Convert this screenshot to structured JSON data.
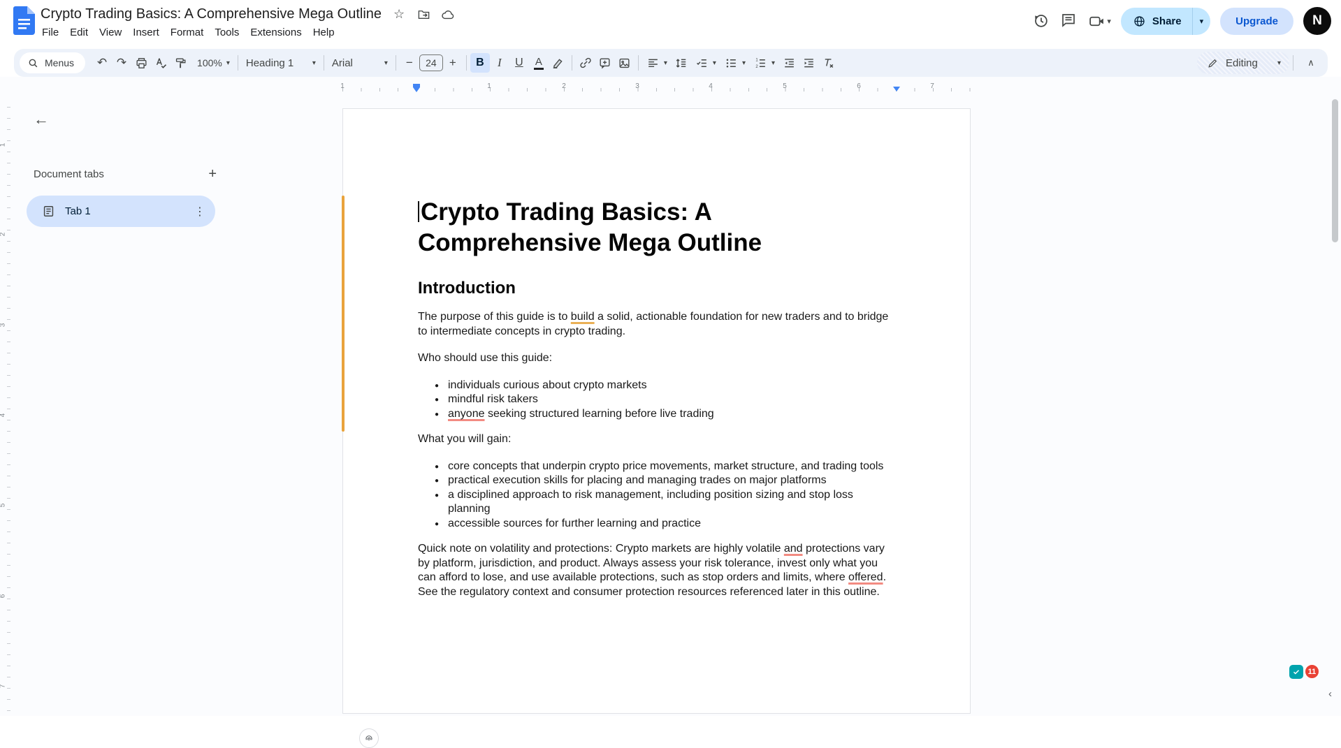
{
  "icons": {
    "star": "☆",
    "back_arrow": "←",
    "plus": "+",
    "overflow_menu": "⋮",
    "caret_down": "▾",
    "chevron_up": "∧",
    "minus": "−",
    "undo": "↶",
    "redo": "↷",
    "panel_collapse": "‹"
  },
  "titlebar": {
    "doc_title": "Crypto Trading Basics: A Comprehensive Mega Outline",
    "menus": [
      "File",
      "Edit",
      "View",
      "Insert",
      "Format",
      "Tools",
      "Extensions",
      "Help"
    ],
    "share_label": "Share",
    "upgrade_label": "Upgrade",
    "avatar_letter": "N"
  },
  "toolbar": {
    "menus_label": "Menus",
    "zoom_value": "100%",
    "style_value": "Heading 1",
    "font_value": "Arial",
    "font_size_value": "24",
    "bold_label": "B",
    "italic_label": "I",
    "underline_label": "U",
    "text_color_label": "A",
    "mode_label": "Editing"
  },
  "tabs_panel": {
    "header": "Document tabs",
    "tabs": [
      {
        "label": "Tab 1"
      }
    ]
  },
  "ruler": {
    "h_numbers": [
      "1",
      "1",
      "2",
      "3",
      "4",
      "5",
      "6",
      "7"
    ],
    "v_numbers": [
      "1",
      "2",
      "3",
      "4",
      "5",
      "6",
      "7"
    ]
  },
  "document": {
    "blocks": [
      {
        "type": "h1",
        "runs": [
          {
            "t": "Crypto Trading Basics: A Comprehensive Mega Outline"
          }
        ]
      },
      {
        "type": "h2",
        "runs": [
          {
            "t": "Introduction"
          }
        ]
      },
      {
        "type": "p",
        "runs": [
          {
            "t": "The purpose of this guide is to "
          },
          {
            "t": "build",
            "mark": "orange"
          },
          {
            "t": " a solid, actionable foundation for new traders and to bridge to intermediate concepts in crypto trading."
          }
        ]
      },
      {
        "type": "p",
        "runs": [
          {
            "t": "Who should use this guide:"
          }
        ]
      },
      {
        "type": "ul",
        "items": [
          [
            {
              "t": "individuals curious about crypto markets"
            }
          ],
          [
            {
              "t": "mindful risk takers"
            }
          ],
          [
            {
              "t": "anyone",
              "mark": "pink"
            },
            {
              "t": " seeking structured learning before live trading"
            }
          ]
        ]
      },
      {
        "type": "p",
        "runs": [
          {
            "t": "What you will gain:"
          }
        ]
      },
      {
        "type": "ul",
        "items": [
          [
            {
              "t": "core concepts that underpin crypto price movements, market structure, and trading tools"
            }
          ],
          [
            {
              "t": "practical execution skills for placing and managing trades on major platforms"
            }
          ],
          [
            {
              "t": "a disciplined approach to risk management, including position sizing and stop loss planning"
            }
          ],
          [
            {
              "t": "accessible sources for further learning and practice"
            }
          ]
        ]
      },
      {
        "type": "p",
        "runs": [
          {
            "t": "Quick note on volatility and protections: Crypto markets are highly volatile "
          },
          {
            "t": "and",
            "mark": "pink"
          },
          {
            "t": " protections vary by platform, jurisdiction, and product. Always assess your risk tolerance, invest only what you can afford to lose, and use available protections, such as stop orders and limits, where "
          },
          {
            "t": "offered",
            "mark": "pink"
          },
          {
            "t": ". See the regulatory context and consumer protection resources referenced later in this outline."
          }
        ]
      }
    ]
  },
  "page_badges": {
    "notification_count": "11"
  },
  "colors": {
    "accent_blue": "#0b57d0",
    "share_pill_blue": "#c2e7ff",
    "selection_blue": "#d3e3fd",
    "toolbar_bg": "#edf2fa",
    "underline_orange": "#eab055",
    "underline_pink": "#f28b82",
    "comment_bar_orange": "#e9a33c",
    "badge_red": "#e94235",
    "badge_teal": "#00a3ad"
  }
}
